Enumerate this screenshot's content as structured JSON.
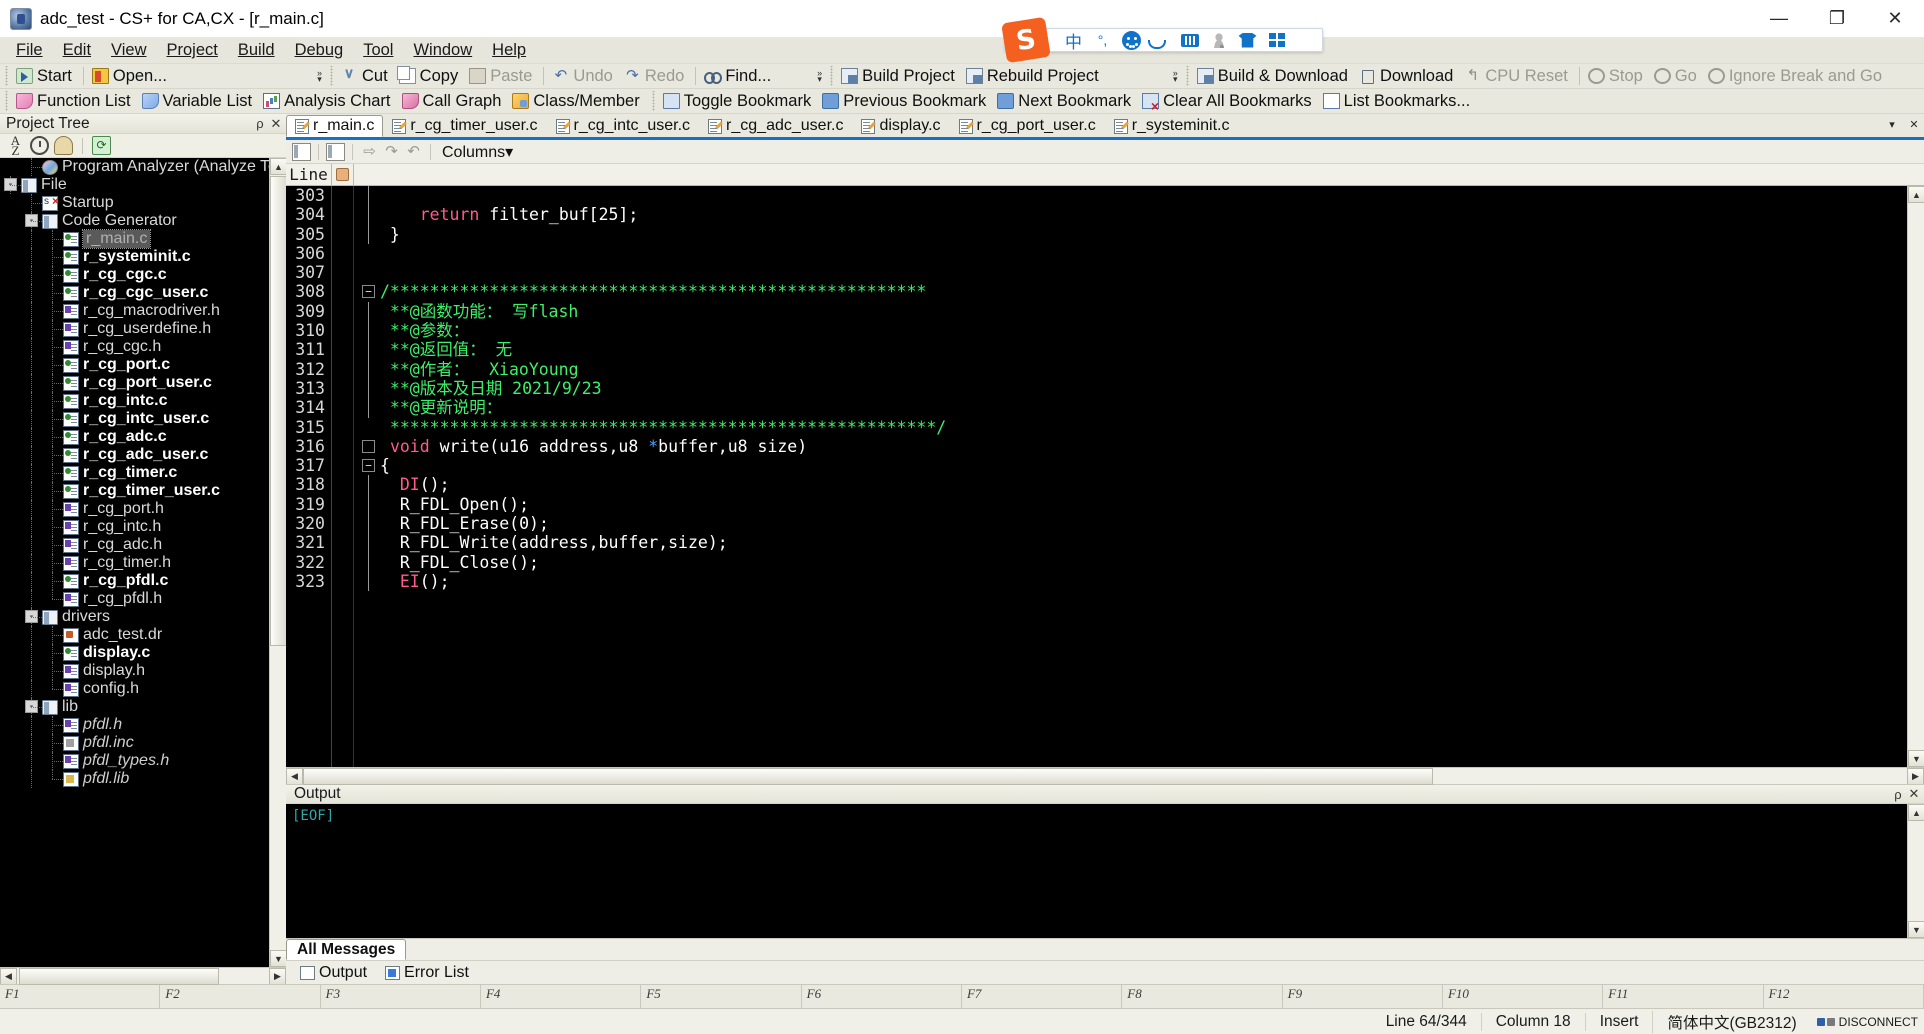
{
  "window": {
    "title": "adc_test - CS+ for CA,CX - [r_main.c]",
    "minimize": "—",
    "maximize": "❐",
    "close": "✕"
  },
  "menu": {
    "items": [
      "File",
      "Edit",
      "View",
      "Project",
      "Build",
      "Debug",
      "Tool",
      "Window",
      "Help"
    ]
  },
  "toolbar_row1": [
    {
      "label": "Start",
      "icon": "start-icon",
      "disabled": false
    },
    {
      "label": "Open...",
      "icon": "open-icon",
      "disabled": false
    },
    {
      "label": "Cut",
      "icon": "cut-icon",
      "disabled": false
    },
    {
      "label": "Copy",
      "icon": "copy-icon",
      "disabled": false
    },
    {
      "label": "Paste",
      "icon": "paste-icon",
      "disabled": true
    },
    {
      "label": "Undo",
      "icon": "undo-icon",
      "disabled": true
    },
    {
      "label": "Redo",
      "icon": "redo-icon",
      "disabled": true
    },
    {
      "label": "Find...",
      "icon": "find-icon",
      "disabled": false
    },
    {
      "label": "Build Project",
      "icon": "build-project-icon",
      "disabled": false
    },
    {
      "label": "Rebuild Project",
      "icon": "rebuild-project-icon",
      "disabled": false
    },
    {
      "label": "Build & Download",
      "icon": "build-download-icon",
      "disabled": false
    },
    {
      "label": "Download",
      "icon": "download-icon",
      "disabled": false
    },
    {
      "label": "CPU Reset",
      "icon": "cpu-reset-icon",
      "disabled": true
    },
    {
      "label": "Stop",
      "icon": "stop-icon",
      "disabled": true
    },
    {
      "label": "Go",
      "icon": "go-icon",
      "disabled": true
    },
    {
      "label": "Ignore Break and Go",
      "icon": "ignore-break-go-icon",
      "disabled": true
    }
  ],
  "toolbar_row2": [
    {
      "label": "Function List",
      "icon": "function-list-icon"
    },
    {
      "label": "Variable List",
      "icon": "variable-list-icon"
    },
    {
      "label": "Analysis Chart",
      "icon": "analysis-chart-icon"
    },
    {
      "label": "Call Graph",
      "icon": "call-graph-icon"
    },
    {
      "label": "Class/Member",
      "icon": "class-member-icon"
    },
    {
      "label": "Toggle Bookmark",
      "icon": "toggle-bookmark-icon"
    },
    {
      "label": "Previous Bookmark",
      "icon": "previous-bookmark-icon"
    },
    {
      "label": "Next Bookmark",
      "icon": "next-bookmark-icon"
    },
    {
      "label": "Clear All Bookmarks",
      "icon": "clear-all-bookmarks-icon"
    },
    {
      "label": "List Bookmarks...",
      "icon": "list-bookmarks-icon"
    }
  ],
  "ime": {
    "logo": "S",
    "items": [
      {
        "name": "language-mode",
        "glyph": "中"
      },
      {
        "name": "punctuation-mode",
        "glyph": "°,"
      },
      {
        "name": "emoji",
        "glyph": ""
      },
      {
        "name": "voice-input",
        "glyph": ""
      },
      {
        "name": "soft-keyboard",
        "glyph": ""
      },
      {
        "name": "user-center",
        "glyph": ""
      },
      {
        "name": "skin",
        "glyph": ""
      },
      {
        "name": "toolbox-menu",
        "glyph": ""
      }
    ]
  },
  "project_tree": {
    "caption": "Project Tree",
    "pin": "ρ",
    "close": "✕",
    "toolbar": [
      "sort-az-icon",
      "history-icon",
      "user-icon",
      "refresh-icon"
    ],
    "nodes": [
      {
        "depth": 2,
        "label": "Program Analyzer (Analyze To",
        "icon": "analyzer-icon",
        "style": "normal",
        "expander": "",
        "connector": "elbow"
      },
      {
        "depth": 1,
        "label": "File",
        "icon": "folder-icon",
        "style": "normal",
        "expander": "-",
        "connector": "elbow"
      },
      {
        "depth": 2,
        "label": "Startup",
        "icon": "startup-icon",
        "style": "normal",
        "expander": "",
        "connector": "elbow"
      },
      {
        "depth": 2,
        "label": "Code Generator",
        "icon": "folder-icon",
        "style": "normal",
        "expander": "-",
        "connector": "elbow"
      },
      {
        "depth": 3,
        "label": "r_main.c",
        "icon": "c-file-icon",
        "style": "selected",
        "expander": "",
        "connector": "elbow"
      },
      {
        "depth": 3,
        "label": "r_systeminit.c",
        "icon": "c-file-icon",
        "style": "bold",
        "expander": "",
        "connector": "elbow"
      },
      {
        "depth": 3,
        "label": "r_cg_cgc.c",
        "icon": "c-file-icon",
        "style": "bold",
        "expander": "",
        "connector": "elbow"
      },
      {
        "depth": 3,
        "label": "r_cg_cgc_user.c",
        "icon": "c-file-icon",
        "style": "bold",
        "expander": "",
        "connector": "elbow"
      },
      {
        "depth": 3,
        "label": "r_cg_macrodriver.h",
        "icon": "h-file-icon",
        "style": "normal",
        "expander": "",
        "connector": "elbow"
      },
      {
        "depth": 3,
        "label": "r_cg_userdefine.h",
        "icon": "h-file-icon",
        "style": "normal",
        "expander": "",
        "connector": "elbow"
      },
      {
        "depth": 3,
        "label": "r_cg_cgc.h",
        "icon": "h-file-icon",
        "style": "normal",
        "expander": "",
        "connector": "elbow"
      },
      {
        "depth": 3,
        "label": "r_cg_port.c",
        "icon": "c-file-icon",
        "style": "bold",
        "expander": "",
        "connector": "elbow"
      },
      {
        "depth": 3,
        "label": "r_cg_port_user.c",
        "icon": "c-file-icon",
        "style": "bold",
        "expander": "",
        "connector": "elbow"
      },
      {
        "depth": 3,
        "label": "r_cg_intc.c",
        "icon": "c-file-icon",
        "style": "bold",
        "expander": "",
        "connector": "elbow"
      },
      {
        "depth": 3,
        "label": "r_cg_intc_user.c",
        "icon": "c-file-icon",
        "style": "bold",
        "expander": "",
        "connector": "elbow"
      },
      {
        "depth": 3,
        "label": "r_cg_adc.c",
        "icon": "c-file-icon",
        "style": "bold",
        "expander": "",
        "connector": "elbow"
      },
      {
        "depth": 3,
        "label": "r_cg_adc_user.c",
        "icon": "c-file-icon",
        "style": "bold",
        "expander": "",
        "connector": "elbow"
      },
      {
        "depth": 3,
        "label": "r_cg_timer.c",
        "icon": "c-file-icon",
        "style": "bold",
        "expander": "",
        "connector": "elbow"
      },
      {
        "depth": 3,
        "label": "r_cg_timer_user.c",
        "icon": "c-file-icon",
        "style": "bold",
        "expander": "",
        "connector": "elbow"
      },
      {
        "depth": 3,
        "label": "r_cg_port.h",
        "icon": "h-file-icon",
        "style": "normal",
        "expander": "",
        "connector": "elbow"
      },
      {
        "depth": 3,
        "label": "r_cg_intc.h",
        "icon": "h-file-icon",
        "style": "normal",
        "expander": "",
        "connector": "elbow"
      },
      {
        "depth": 3,
        "label": "r_cg_adc.h",
        "icon": "h-file-icon",
        "style": "normal",
        "expander": "",
        "connector": "elbow"
      },
      {
        "depth": 3,
        "label": "r_cg_timer.h",
        "icon": "h-file-icon",
        "style": "normal",
        "expander": "",
        "connector": "elbow"
      },
      {
        "depth": 3,
        "label": "r_cg_pfdl.c",
        "icon": "c-file-icon",
        "style": "bold",
        "expander": "",
        "connector": "elbow"
      },
      {
        "depth": 3,
        "label": "r_cg_pfdl.h",
        "icon": "h-file-icon",
        "style": "normal",
        "expander": "",
        "connector": "last"
      },
      {
        "depth": 2,
        "label": "drivers",
        "icon": "folder-icon",
        "style": "normal",
        "expander": "-",
        "connector": "elbow"
      },
      {
        "depth": 3,
        "label": "adc_test.dr",
        "icon": "dr-file-icon",
        "style": "normal",
        "expander": "",
        "connector": "elbow"
      },
      {
        "depth": 3,
        "label": "display.c",
        "icon": "c-file-icon",
        "style": "bold",
        "expander": "",
        "connector": "elbow"
      },
      {
        "depth": 3,
        "label": "display.h",
        "icon": "h-file-icon",
        "style": "normal",
        "expander": "",
        "connector": "elbow"
      },
      {
        "depth": 3,
        "label": "config.h",
        "icon": "h-file-icon",
        "style": "normal",
        "expander": "",
        "connector": "last"
      },
      {
        "depth": 2,
        "label": "lib",
        "icon": "folder-icon",
        "style": "normal",
        "expander": "-",
        "connector": "elbow"
      },
      {
        "depth": 3,
        "label": "pfdl.h",
        "icon": "h-file-icon",
        "style": "italic",
        "expander": "",
        "connector": "elbow"
      },
      {
        "depth": 3,
        "label": "pfdl.inc",
        "icon": "inc-file-icon",
        "style": "italic",
        "expander": "",
        "connector": "elbow"
      },
      {
        "depth": 3,
        "label": "pfdl_types.h",
        "icon": "h-file-icon",
        "style": "italic",
        "expander": "",
        "connector": "elbow"
      },
      {
        "depth": 3,
        "label": "pfdl.lib",
        "icon": "lib-file-icon",
        "style": "italic",
        "expander": "",
        "connector": "last"
      }
    ]
  },
  "editor": {
    "tabs": [
      {
        "label": "r_main.c",
        "active": true
      },
      {
        "label": "r_cg_timer_user.c",
        "active": false
      },
      {
        "label": "r_cg_intc_user.c",
        "active": false
      },
      {
        "label": "r_cg_adc_user.c",
        "active": false
      },
      {
        "label": "display.c",
        "active": false
      },
      {
        "label": "r_cg_port_user.c",
        "active": false
      },
      {
        "label": "r_systeminit.c",
        "active": false
      }
    ],
    "tab_nav": {
      "dropdown": "▾",
      "close": "✕"
    },
    "toolbar": {
      "columns_label": "Columns",
      "columns_caret": "▾",
      "buttons": [
        "bookmark-next-icon",
        "bookmark-prev-icon",
        "goto-icon",
        "undo-icon",
        "redo-icon"
      ]
    },
    "gutter_header": {
      "line": "Line",
      "bookmark_icon": "hand-pointer-icon"
    },
    "lines": [
      {
        "n": "303",
        "fold": "",
        "bar": true,
        "tokens": [
          {
            "t": "",
            "c": "k-pl"
          }
        ]
      },
      {
        "n": "304",
        "fold": "",
        "bar": true,
        "tokens": [
          {
            "t": "    ",
            "c": "k-pl"
          },
          {
            "t": "return",
            "c": "k-kw"
          },
          {
            "t": " filter_buf[25];",
            "c": "k-pl"
          }
        ]
      },
      {
        "n": "305",
        "fold": "",
        "bar": true,
        "tokens": [
          {
            "t": " }",
            "c": "k-pl"
          }
        ]
      },
      {
        "n": "306",
        "fold": "",
        "bar": false,
        "tokens": [
          {
            "t": "",
            "c": "k-pl"
          }
        ]
      },
      {
        "n": "307",
        "fold": "",
        "bar": false,
        "tokens": [
          {
            "t": "",
            "c": "k-pl"
          }
        ]
      },
      {
        "n": "308",
        "fold": "-",
        "bar": false,
        "tokens": [
          {
            "t": "/******************************************************",
            "c": "k-cm"
          }
        ]
      },
      {
        "n": "309",
        "fold": "",
        "bar": true,
        "tokens": [
          {
            "t": " **@函数功能： 写flash",
            "c": "k-cm"
          }
        ]
      },
      {
        "n": "310",
        "fold": "",
        "bar": true,
        "tokens": [
          {
            "t": " **@参数：",
            "c": "k-cm"
          }
        ]
      },
      {
        "n": "311",
        "fold": "",
        "bar": true,
        "tokens": [
          {
            "t": " **@返回值： 无",
            "c": "k-cm"
          }
        ]
      },
      {
        "n": "312",
        "fold": "",
        "bar": true,
        "tokens": [
          {
            "t": " **@作者：  XiaoYoung",
            "c": "k-cm"
          }
        ]
      },
      {
        "n": "313",
        "fold": "",
        "bar": true,
        "tokens": [
          {
            "t": " **@版本及日期 2021/9/23",
            "c": "k-cm"
          }
        ]
      },
      {
        "n": "314",
        "fold": "",
        "bar": true,
        "tokens": [
          {
            "t": " **@更新说明：",
            "c": "k-cm"
          }
        ]
      },
      {
        "n": "315",
        "fold": "",
        "bar": false,
        "tokens": [
          {
            "t": " *******************************************************/",
            "c": "k-cm"
          }
        ]
      },
      {
        "n": "316",
        "fold": "■",
        "bar": false,
        "tokens": [
          {
            "t": " ",
            "c": "k-pl"
          },
          {
            "t": "void",
            "c": "k-kw"
          },
          {
            "t": " write(u16 address,u8 ",
            "c": "k-pl"
          },
          {
            "t": "*",
            "c": "k-op"
          },
          {
            "t": "buffer,u8 size)",
            "c": "k-pl"
          }
        ]
      },
      {
        "n": "317",
        "fold": "-",
        "bar": false,
        "tokens": [
          {
            "t": "{",
            "c": "k-pl"
          }
        ]
      },
      {
        "n": "318",
        "fold": "",
        "bar": true,
        "tokens": [
          {
            "t": "  ",
            "c": "k-pl"
          },
          {
            "t": "DI",
            "c": "k-kw"
          },
          {
            "t": "();",
            "c": "k-pl"
          }
        ]
      },
      {
        "n": "319",
        "fold": "",
        "bar": true,
        "tokens": [
          {
            "t": "  R_FDL_Open();",
            "c": "k-pl"
          }
        ]
      },
      {
        "n": "320",
        "fold": "",
        "bar": true,
        "tokens": [
          {
            "t": "  R_FDL_Erase(0);",
            "c": "k-pl"
          }
        ]
      },
      {
        "n": "321",
        "fold": "",
        "bar": true,
        "tokens": [
          {
            "t": "  R_FDL_Write(address,buffer,size);",
            "c": "k-pl"
          }
        ]
      },
      {
        "n": "322",
        "fold": "",
        "bar": true,
        "tokens": [
          {
            "t": "  R_FDL_Close();",
            "c": "k-pl"
          }
        ]
      },
      {
        "n": "323",
        "fold": "",
        "bar": true,
        "tokens": [
          {
            "t": "  ",
            "c": "k-pl"
          },
          {
            "t": "EI",
            "c": "k-kw"
          },
          {
            "t": "();",
            "c": "k-pl"
          }
        ]
      }
    ]
  },
  "output": {
    "caption": "Output",
    "pin": "ρ",
    "close": "✕",
    "text": "[EOF]",
    "tabs": [
      {
        "label": "All Messages",
        "active": true
      }
    ]
  },
  "bottom_tabs": [
    {
      "label": "Output",
      "icon": "output-icon",
      "active": true
    },
    {
      "label": "Error List",
      "icon": "error-list-icon",
      "active": false
    }
  ],
  "fkeys": [
    "F1",
    "F2",
    "F3",
    "F4",
    "F5",
    "F6",
    "F7",
    "F8",
    "F9",
    "F10",
    "F11",
    "F12"
  ],
  "statusbar": {
    "line": "Line 64/344",
    "column": "Column 18",
    "insert": "Insert",
    "encoding": "简体中文(GB2312)",
    "connection": "DISCONNECT"
  },
  "colors": {
    "accent": "#1b6ec2",
    "comment_green": "#3cf06a",
    "keyword_pink": "#ff5b8f",
    "editor_bg": "#000000",
    "chrome": "#e8e8de",
    "ime_orange": "#f4601f",
    "ime_blue": "#1272c8"
  }
}
